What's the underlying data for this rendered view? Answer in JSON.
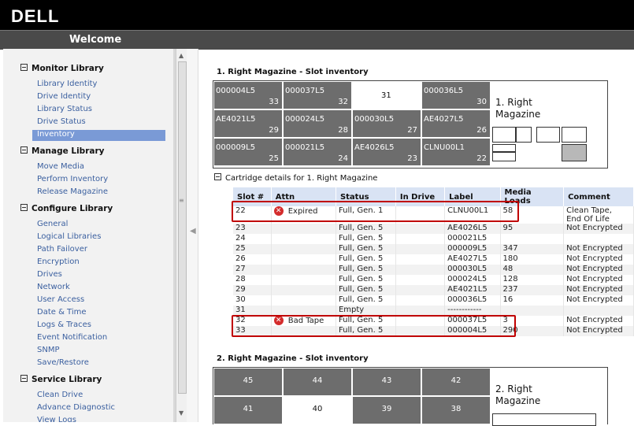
{
  "brand": "DELL",
  "window_title": "Welcome",
  "sidebar": {
    "sections": [
      {
        "title": "Monitor Library",
        "items": [
          "Library Identity",
          "Drive Identity",
          "Library Status",
          "Drive Status",
          "Inventory"
        ]
      },
      {
        "title": "Manage Library",
        "items": [
          "Move Media",
          "Perform Inventory",
          "Release Magazine"
        ]
      },
      {
        "title": "Configure Library",
        "items": [
          "General",
          "Logical Libraries",
          "Path Failover",
          "Encryption",
          "Drives",
          "Network",
          "User Access",
          "Date & Time",
          "Logs & Traces",
          "Event Notification",
          "SNMP",
          "Save/Restore"
        ]
      },
      {
        "title": "Service Library",
        "items": [
          "Clean Drive",
          "Advance Diagnostic",
          "View Logs"
        ]
      }
    ],
    "selected": "Inventory"
  },
  "magazine1": {
    "title": "1. Right Magazine - Slot inventory",
    "label_line1": "1. Right",
    "label_line2": "Magazine",
    "slots": [
      {
        "label": "000004L5",
        "num": "33"
      },
      {
        "label": "000037L5",
        "num": "32"
      },
      {
        "label": "",
        "num": "31"
      },
      {
        "label": "000036L5",
        "num": "30"
      },
      {
        "label": "AE4021L5",
        "num": "29"
      },
      {
        "label": "000024L5",
        "num": "28"
      },
      {
        "label": "000030L5",
        "num": "27"
      },
      {
        "label": "AE4027L5",
        "num": "26"
      },
      {
        "label": "000009L5",
        "num": "25"
      },
      {
        "label": "000021L5",
        "num": "24"
      },
      {
        "label": "AE4026L5",
        "num": "23"
      },
      {
        "label": "CLNU00L1",
        "num": "22"
      }
    ]
  },
  "cartridge": {
    "header": "Cartridge details for 1. Right Magazine",
    "columns": [
      "Slot #",
      "Attn",
      "Status",
      "In Drive",
      "Label",
      "Media Loads",
      "Comment"
    ],
    "rows": [
      {
        "slot": "22",
        "attn": "Expired",
        "status": "Full, Gen. 1",
        "in_drive": "",
        "label": "CLNU00L1",
        "loads": "58",
        "comment": "Clean Tape,",
        "comment2": "End Of Life"
      },
      {
        "slot": "23",
        "attn": "",
        "status": "Full, Gen. 5",
        "in_drive": "",
        "label": "AE4026L5",
        "loads": "95",
        "comment": "Not Encrypted",
        "comment2": ""
      },
      {
        "slot": "24",
        "attn": "",
        "status": "Full, Gen. 5",
        "in_drive": "",
        "label": "000021L5",
        "loads": "",
        "comment": "",
        "comment2": ""
      },
      {
        "slot": "25",
        "attn": "",
        "status": "Full, Gen. 5",
        "in_drive": "",
        "label": "000009L5",
        "loads": "347",
        "comment": "Not Encrypted",
        "comment2": ""
      },
      {
        "slot": "26",
        "attn": "",
        "status": "Full, Gen. 5",
        "in_drive": "",
        "label": "AE4027L5",
        "loads": "180",
        "comment": "Not Encrypted",
        "comment2": ""
      },
      {
        "slot": "27",
        "attn": "",
        "status": "Full, Gen. 5",
        "in_drive": "",
        "label": "000030L5",
        "loads": "48",
        "comment": "Not Encrypted",
        "comment2": ""
      },
      {
        "slot": "28",
        "attn": "",
        "status": "Full, Gen. 5",
        "in_drive": "",
        "label": "000024L5",
        "loads": "128",
        "comment": "Not Encrypted",
        "comment2": ""
      },
      {
        "slot": "29",
        "attn": "",
        "status": "Full, Gen. 5",
        "in_drive": "",
        "label": "AE4021L5",
        "loads": "237",
        "comment": "Not Encrypted",
        "comment2": ""
      },
      {
        "slot": "30",
        "attn": "",
        "status": "Full, Gen. 5",
        "in_drive": "",
        "label": "000036L5",
        "loads": "16",
        "comment": "Not Encrypted",
        "comment2": ""
      },
      {
        "slot": "31",
        "attn": "",
        "status": "Empty",
        "in_drive": "",
        "label": "------------",
        "loads": "",
        "comment": "",
        "comment2": ""
      },
      {
        "slot": "32",
        "attn": "Bad Tape",
        "status": "Full, Gen. 5",
        "in_drive": "",
        "label": "000037L5",
        "loads": "3",
        "comment": "Not Encrypted",
        "comment2": ""
      },
      {
        "slot": "33",
        "attn": "",
        "status": "Full, Gen. 5",
        "in_drive": "",
        "label": "000004L5",
        "loads": "290",
        "comment": "Not Encrypted",
        "comment2": ""
      }
    ]
  },
  "magazine2": {
    "title": "2. Right Magazine - Slot inventory",
    "label_line1": "2. Right",
    "label_line2": "Magazine",
    "slots": [
      {
        "num": "45",
        "empty": false
      },
      {
        "num": "44",
        "empty": false
      },
      {
        "num": "43",
        "empty": false
      },
      {
        "num": "42",
        "empty": false
      },
      {
        "num": "41",
        "empty": false
      },
      {
        "num": "40",
        "empty": true
      },
      {
        "num": "39",
        "empty": false
      },
      {
        "num": "38",
        "empty": false
      }
    ]
  }
}
